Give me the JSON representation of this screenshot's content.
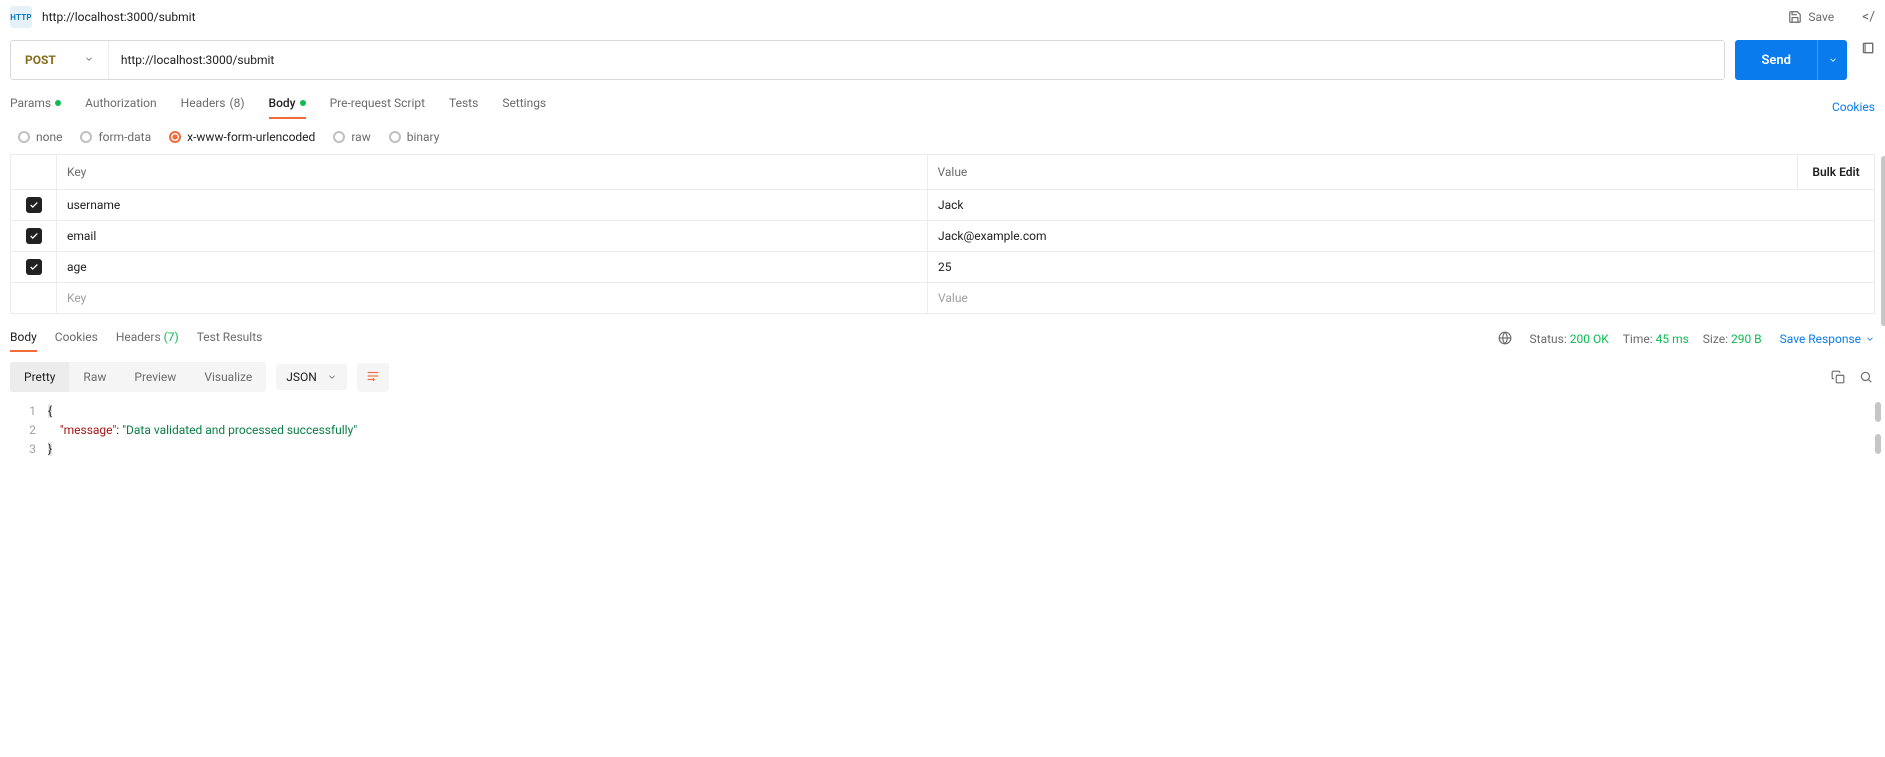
{
  "top": {
    "title": "http://localhost:3000/submit",
    "save": "Save"
  },
  "request": {
    "method": "POST",
    "url": "http://localhost:3000/submit",
    "send": "Send"
  },
  "tabs": {
    "params": "Params",
    "authorization": "Authorization",
    "headers_label": "Headers",
    "headers_count": "(8)",
    "body": "Body",
    "prerequest": "Pre-request Script",
    "tests": "Tests",
    "settings": "Settings",
    "cookies": "Cookies"
  },
  "bodyType": {
    "none": "none",
    "formdata": "form-data",
    "urlencoded": "x-www-form-urlencoded",
    "raw": "raw",
    "binary": "binary"
  },
  "kv": {
    "key_header": "Key",
    "value_header": "Value",
    "bulk_edit": "Bulk Edit",
    "rows": [
      {
        "key": "username",
        "value": "Jack"
      },
      {
        "key": "email",
        "value": "Jack@example.com"
      },
      {
        "key": "age",
        "value": "25"
      }
    ],
    "key_placeholder": "Key",
    "value_placeholder": "Value"
  },
  "resp": {
    "tabs": {
      "body": "Body",
      "cookies": "Cookies",
      "headers_label": "Headers",
      "headers_count": "(7)",
      "test_results": "Test Results"
    },
    "status_label": "Status:",
    "status_value": "200 OK",
    "time_label": "Time:",
    "time_value": "45 ms",
    "size_label": "Size:",
    "size_value": "290 B",
    "save_response": "Save Response"
  },
  "viewer": {
    "pretty": "Pretty",
    "raw": "Raw",
    "preview": "Preview",
    "visualize": "Visualize",
    "format": "JSON"
  },
  "json_body": {
    "l1": "{",
    "l2_key": "\"message\"",
    "l2_sep": ": ",
    "l2_val": "\"Data validated and processed successfully\"",
    "l3": "}"
  }
}
